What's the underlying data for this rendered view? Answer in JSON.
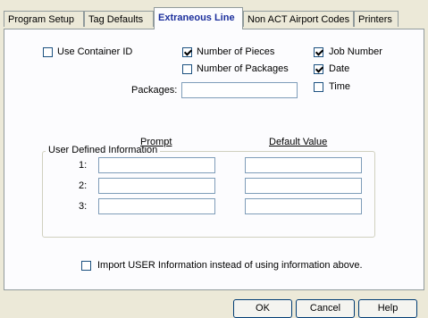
{
  "tabs": [
    {
      "label": "Program Setup",
      "active": false
    },
    {
      "label": "Tag Defaults",
      "active": false
    },
    {
      "label": "Extraneous Line",
      "active": true
    },
    {
      "label": "Non ACT Airport Codes",
      "active": false
    },
    {
      "label": "Printers",
      "active": false
    }
  ],
  "options": {
    "use_container_id": {
      "label": "Use Container ID",
      "checked": false
    },
    "number_of_pieces": {
      "label": "Number of Pieces",
      "checked": true
    },
    "number_of_packages": {
      "label": "Number of Packages",
      "checked": false
    },
    "job_number": {
      "label": "Job Number",
      "checked": true
    },
    "date": {
      "label": "Date",
      "checked": true
    },
    "time": {
      "label": "Time",
      "checked": false
    }
  },
  "packages": {
    "label": "Packages:",
    "value": ""
  },
  "user_defined": {
    "title": "User Defined Information",
    "prompt_header": "Prompt",
    "default_header": "Default Value",
    "rows": [
      {
        "label": "1:",
        "prompt": "",
        "default": ""
      },
      {
        "label": "2:",
        "prompt": "",
        "default": ""
      },
      {
        "label": "3:",
        "prompt": "",
        "default": ""
      }
    ]
  },
  "import_user": {
    "label": "Import USER Information instead of using information above.",
    "checked": false
  },
  "buttons": {
    "ok": "OK",
    "cancel": "Cancel",
    "help": "Help"
  }
}
